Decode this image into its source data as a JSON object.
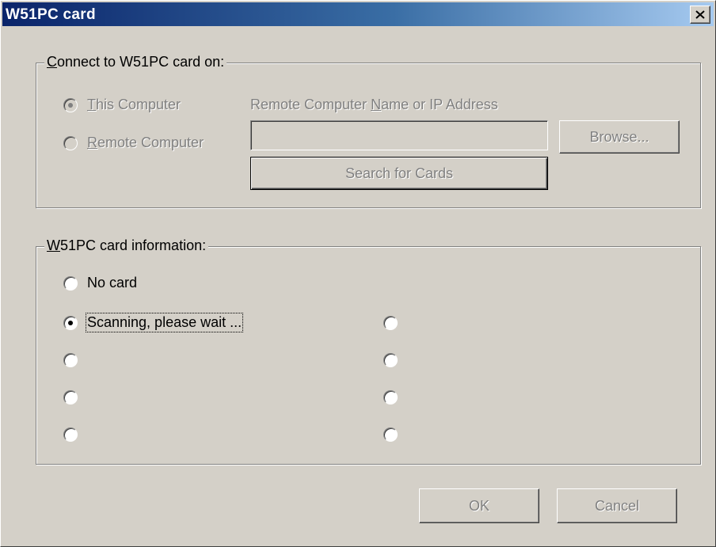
{
  "window": {
    "title": "W51PC card"
  },
  "connect_group": {
    "legend_mnemonic": "C",
    "legend_rest": "onnect to W51PC card on:",
    "this_computer": {
      "mnemonic": "T",
      "rest": "his Computer",
      "selected": true
    },
    "remote_computer": {
      "mnemonic": "R",
      "rest": "emote Computer",
      "selected": false
    },
    "remote_name_label_pre": "Remote Computer ",
    "remote_name_label_mnemonic": "N",
    "remote_name_label_post": "ame or IP Address",
    "remote_name_value": "",
    "browse_label": "Browse...",
    "search_label": "Search for Cards"
  },
  "info_group": {
    "legend_mnemonic": "W",
    "legend_rest": "51PC card information:",
    "no_card_label": "No card",
    "options_left": [
      "Scanning, please wait ...",
      "",
      "",
      ""
    ],
    "options_right": [
      "",
      "",
      "",
      ""
    ],
    "selected": "Scanning, please wait ..."
  },
  "footer": {
    "ok_label": "OK",
    "cancel_label": "Cancel"
  },
  "colors": {
    "face": "#d4d0c8",
    "title_start": "#0a246a",
    "title_end": "#a6caf0",
    "disabled_text": "#808080"
  }
}
